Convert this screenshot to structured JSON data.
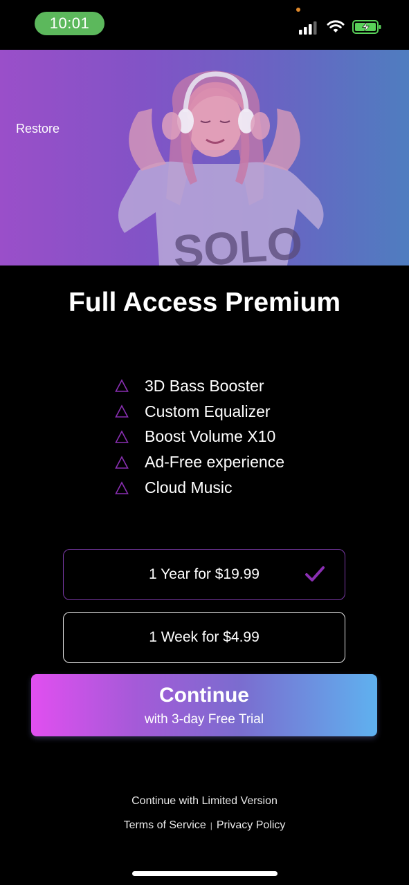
{
  "status_bar": {
    "time": "10:01",
    "icons": [
      "signal-icon",
      "wifi-icon",
      "battery-charging-icon"
    ]
  },
  "hero": {
    "restore_label": "Restore",
    "image": "woman-with-headphones",
    "gradient_colors": [
      "#9a4fc9",
      "#4f7dc0"
    ]
  },
  "title": "Full Access Premium",
  "features": [
    {
      "icon": "triangle-icon",
      "label": "3D Bass Booster"
    },
    {
      "icon": "triangle-icon",
      "label": "Custom Equalizer"
    },
    {
      "icon": "triangle-icon",
      "label": "Boost Volume X10"
    },
    {
      "icon": "triangle-icon",
      "label": "Ad-Free experience"
    },
    {
      "icon": "triangle-icon",
      "label": "Cloud Music"
    }
  ],
  "plans": [
    {
      "label": "1 Year for $19.99",
      "selected": true
    },
    {
      "label": "1 Week for $4.99",
      "selected": false
    }
  ],
  "continue_button": {
    "label": "Continue",
    "sublabel": "with 3-day Free Trial",
    "gradient_colors": [
      "#e14ff0",
      "#5fb1ef"
    ]
  },
  "footer": {
    "limited_label": "Continue with Limited Version",
    "terms_label": "Terms of Service",
    "separator": "|",
    "privacy_label": "Privacy Policy"
  },
  "colors": {
    "accent_purple": "#7b3aa8",
    "status_green": "#5cb85c",
    "battery_green": "#5ad15a"
  }
}
